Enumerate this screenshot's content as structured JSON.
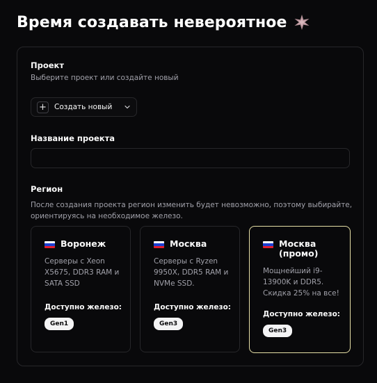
{
  "page": {
    "title": "Время создавать невероятное"
  },
  "project": {
    "label": "Проект",
    "hint": "Выберите проект или создайте новый",
    "create_button_label": "Создать новый"
  },
  "project_name": {
    "label": "Название проекта",
    "value": "",
    "placeholder": ""
  },
  "region": {
    "label": "Регион",
    "hint": "После создания проекта регион изменить будет невозможно, поэтому выбирайте, ориентируясь на необходимое железо.",
    "available_label": "Доступно железо:",
    "flag_colors": [
      "#ffffff",
      "#1c3fd1",
      "#e11d2e"
    ],
    "selected_border_color": "#e6dfa6",
    "options": [
      {
        "name": "Воронеж",
        "description": "Серверы с Xeon X5675, DDR3 RAM и SATA SSD",
        "hardware": "Gen1",
        "selected": false
      },
      {
        "name": "Москва",
        "description": "Серверы с Ryzen 9950X, DDR5 RAM и NVMe SSD.",
        "hardware": "Gen3",
        "selected": false
      },
      {
        "name": "Москва (промо)",
        "description": "Мощнейший i9-13900K и DDR5. Скидка 25% на все!",
        "hardware": "Gen3",
        "selected": true
      }
    ]
  },
  "icons": {
    "title_icon": "sparkle-icon",
    "plus": "plus-icon",
    "chevron": "chevron-down-icon",
    "flag": "flag-russia-icon"
  }
}
